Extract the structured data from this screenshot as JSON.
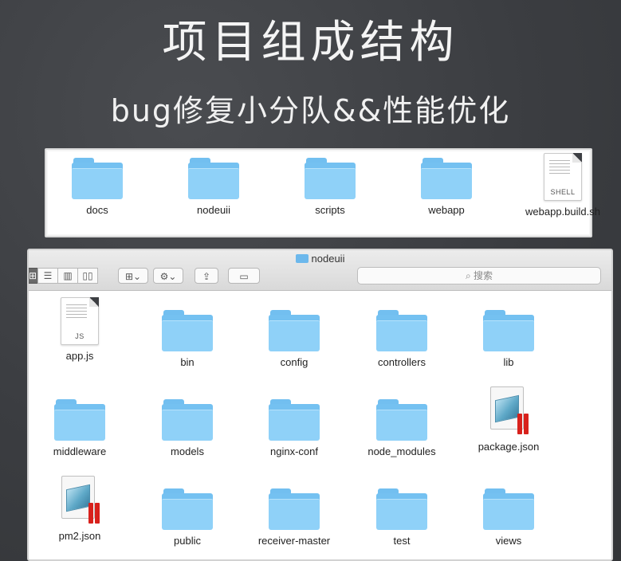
{
  "title": "项目组成结构",
  "subtitle": "bug修复小分队&&性能优化",
  "top_panel": {
    "items": [
      {
        "label": "docs",
        "type": "folder"
      },
      {
        "label": "nodeuii",
        "type": "folder"
      },
      {
        "label": "scripts",
        "type": "folder"
      },
      {
        "label": "webapp",
        "type": "folder"
      },
      {
        "label": "webapp.build.sh",
        "type": "file",
        "tag": "SHELL"
      }
    ]
  },
  "finder": {
    "window_title": "nodeuii",
    "search_placeholder": "搜索",
    "toolbar_icons": [
      "icon-view",
      "list-view",
      "column-view",
      "cover-flow-view",
      "arrange-menu",
      "action-gear-menu",
      "share-icon",
      "tag-icon"
    ],
    "items": [
      {
        "label": "app.js",
        "type": "file",
        "tag": "JS"
      },
      {
        "label": "bin",
        "type": "folder"
      },
      {
        "label": "config",
        "type": "folder"
      },
      {
        "label": "controllers",
        "type": "folder"
      },
      {
        "label": "lib",
        "type": "folder"
      },
      {
        "label": "middleware",
        "type": "folder"
      },
      {
        "label": "models",
        "type": "folder"
      },
      {
        "label": "nginx-conf",
        "type": "folder"
      },
      {
        "label": "node_modules",
        "type": "folder"
      },
      {
        "label": "package.json",
        "type": "json"
      },
      {
        "label": "pm2.json",
        "type": "json"
      },
      {
        "label": "public",
        "type": "folder"
      },
      {
        "label": "receiver-master",
        "type": "folder"
      },
      {
        "label": "test",
        "type": "folder"
      },
      {
        "label": "views",
        "type": "folder"
      }
    ]
  },
  "colors": {
    "background": "#3d3f43",
    "folder": "#8fd1f8",
    "folder_back": "#74c1f1",
    "json_bar": "#d8211c"
  }
}
